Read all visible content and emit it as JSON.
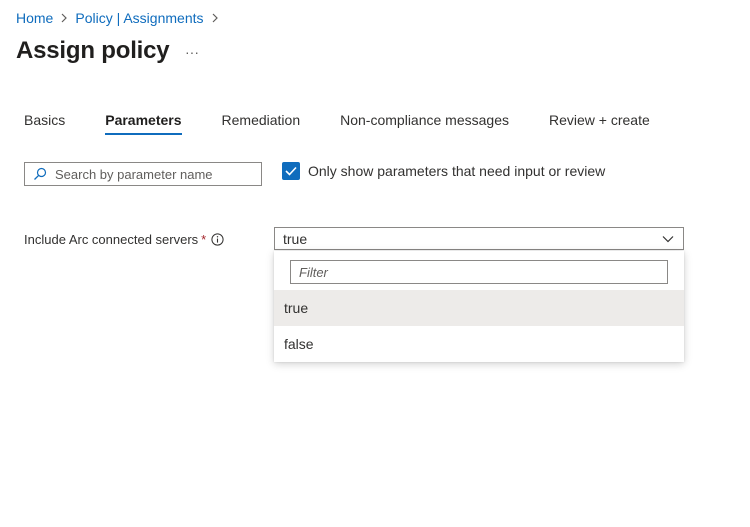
{
  "breadcrumb": {
    "items": [
      "Home",
      "Policy | Assignments"
    ]
  },
  "page": {
    "title": "Assign policy",
    "more_label": "···"
  },
  "tabs": [
    {
      "label": "Basics",
      "active": false
    },
    {
      "label": "Parameters",
      "active": true
    },
    {
      "label": "Remediation",
      "active": false
    },
    {
      "label": "Non-compliance messages",
      "active": false
    },
    {
      "label": "Review + create",
      "active": false
    }
  ],
  "search": {
    "placeholder": "Search by parameter name",
    "value": ""
  },
  "filter_checkbox": {
    "label": "Only show parameters that need input or review",
    "checked": true
  },
  "parameter": {
    "label": "Include Arc connected servers",
    "required_mark": "*",
    "selected_value": "true",
    "dropdown": {
      "filter_placeholder": "Filter",
      "options": [
        "true",
        "false"
      ],
      "selected_index": 0
    }
  },
  "colors": {
    "accent": "#0f6cbd",
    "required": "#a4262c",
    "selected_option_bg": "#edebe9"
  }
}
